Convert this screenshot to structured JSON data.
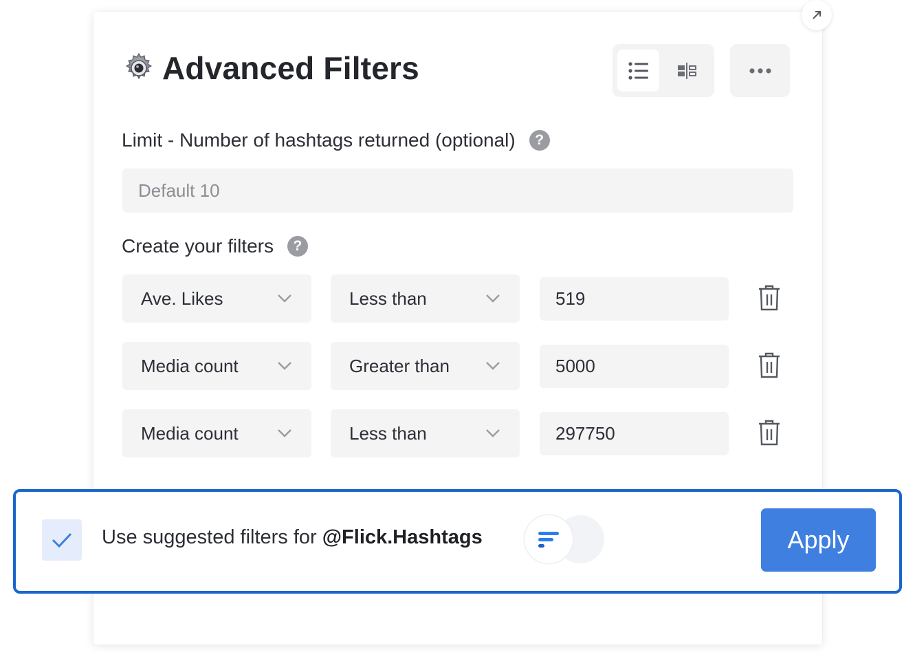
{
  "header": {
    "title": "Advanced Filters",
    "title_icon": "gear-icon",
    "view_options": [
      "list-view-icon",
      "split-view-icon"
    ],
    "more_icon": "more-horizontal-icon",
    "corner_icon": "expand-arrow-icon"
  },
  "limit": {
    "label": "Limit - Number of hashtags returned (optional)",
    "help": "?",
    "placeholder": "Default 10",
    "value": ""
  },
  "filters": {
    "label": "Create your filters",
    "help": "?",
    "rows": [
      {
        "field": "Ave. Likes",
        "operator": "Less than",
        "value": "519"
      },
      {
        "field": "Media count",
        "operator": "Greater than",
        "value": "5000"
      },
      {
        "field": "Media count",
        "operator": "Less than",
        "value": "297750"
      }
    ]
  },
  "suggested": {
    "checked": true,
    "text": "Use suggested filters for ",
    "handle": "@Flick.Hashtags",
    "apply_label": "Apply"
  },
  "colors": {
    "accent": "#3f7fe0",
    "highlight_border": "#1a66cc",
    "checkbox_bg": "#e5edfc",
    "field_bg": "#f4f4f5"
  }
}
